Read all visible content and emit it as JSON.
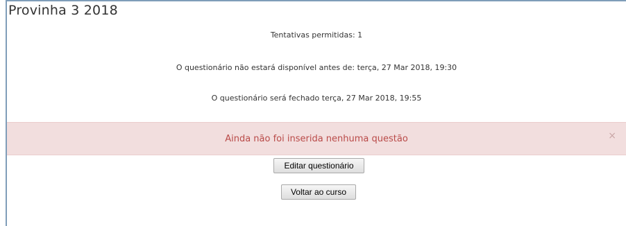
{
  "quiz": {
    "title": "Provinha 3 2018",
    "attempts_allowed": "Tentativas permitidas: 1",
    "opens": "O questionário não estará disponível antes de: terça, 27 Mar 2018, 19:30",
    "closes": "O questionário será fechado terça, 27 Mar 2018, 19:55"
  },
  "alert": {
    "message": "Ainda não foi inserida nenhuma questão",
    "close_glyph": "×",
    "color": "#b94a48",
    "background": "#f2dede"
  },
  "buttons": {
    "edit_label": "Editar questionário",
    "back_label": "Voltar ao curso"
  }
}
